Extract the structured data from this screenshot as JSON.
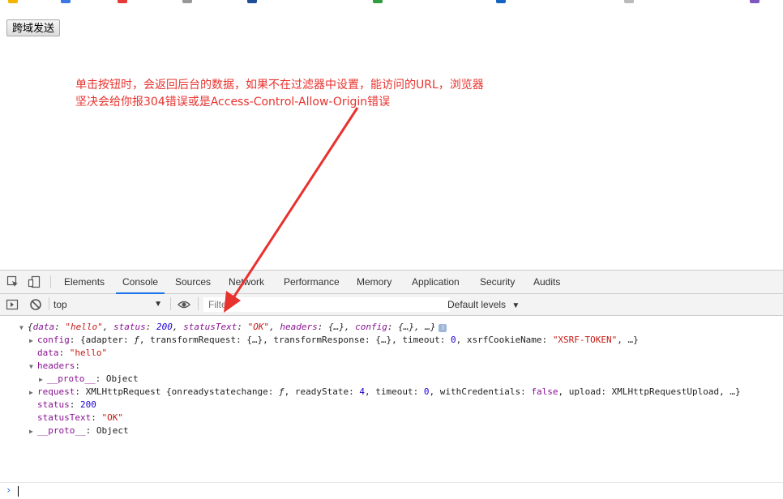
{
  "page": {
    "send_button": "跨域发送",
    "note_line1": "单击按钮时，会返回后台的数据，如果不在过滤器中设置，能访问的URL，浏览器",
    "note_line2": "坚决会给你报304错误或是Access-Control-Allow-Origin错误"
  },
  "devtools": {
    "tabs": [
      "Elements",
      "Console",
      "Sources",
      "Network",
      "Performance",
      "Memory",
      "Application",
      "Security",
      "Audits"
    ],
    "active_tab": "Console",
    "context": "top",
    "filter_placeholder": "Filter",
    "levels": "Default levels"
  },
  "console": {
    "l1": {
      "open": "{",
      "k1": "data",
      "v1": "\"hello\"",
      "k2": "status",
      "v2": "200",
      "k3": "statusText",
      "v3": "\"OK\"",
      "k4": "headers",
      "v4": "{…}",
      "k5": "config",
      "v5": "{…}",
      "tail": "…}"
    },
    "l2": {
      "key": "config",
      "body1": "{adapter: ",
      "f": "ƒ",
      "body2": ", transformRequest: {…}, transformResponse: {…}, timeout: ",
      "timeout": "0",
      "body3": ", xsrfCookieName: ",
      "xsrf": "\"XSRF-TOKEN\"",
      "tail": ", …}"
    },
    "l3": {
      "key": "data",
      "val": "\"hello\""
    },
    "l4": {
      "key": "headers"
    },
    "l5": {
      "key": "__proto__",
      "val": "Object"
    },
    "l6": {
      "key": "request",
      "cls": "XMLHttpRequest ",
      "body1": "{onreadystatechange: ",
      "f": "ƒ",
      "body2": ", readyState: ",
      "rs": "4",
      "body3": ", timeout: ",
      "to": "0",
      "body4": ", withCredentials: ",
      "wc": "false",
      "body5": ", upload: XMLHttpRequestUpload, …}"
    },
    "l7": {
      "key": "status",
      "val": "200"
    },
    "l8": {
      "key": "statusText",
      "val": "\"OK\""
    },
    "l9": {
      "key": "__proto__",
      "val": "Object"
    }
  },
  "colors": {
    "arrow": "#e8322e",
    "note": "#e8322e",
    "tab_underline": "#1a73e8"
  }
}
